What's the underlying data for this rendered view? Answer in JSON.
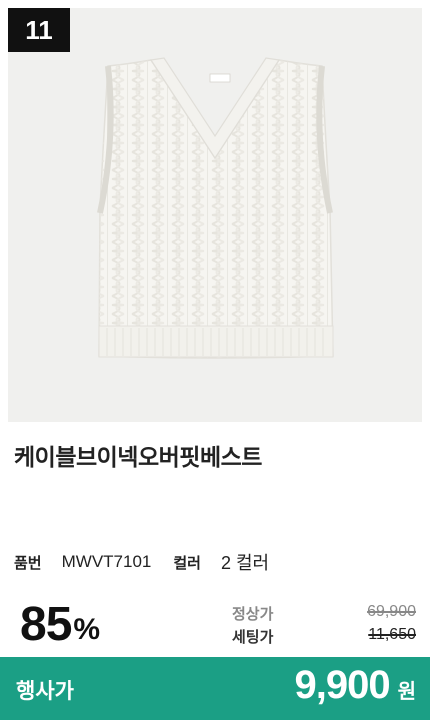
{
  "badge": {
    "rank": "11"
  },
  "product": {
    "name": "케이블브이넥오버핏베스트",
    "image_icon": "knit-vest-image",
    "code_label": "품번",
    "code_value": "MWVT7101",
    "color_label": "컬러",
    "color_value": "2 컬러"
  },
  "pricing": {
    "discount_value": "85",
    "discount_unit": "%",
    "regular_label": "정상가",
    "regular_price": "69,900",
    "set_label": "세팅가",
    "set_price": "11,650",
    "event_label": "행사가",
    "event_price": "9,900",
    "event_unit": "원"
  },
  "colors": {
    "badge_bg": "#111111",
    "event_bar_bg": "#1b9f85",
    "photo_bg": "#f0f0ee",
    "vest": "#f6f5f1"
  }
}
